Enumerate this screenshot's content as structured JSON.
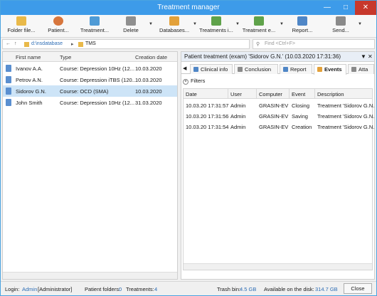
{
  "window": {
    "title": "Treatment manager"
  },
  "toolbar": {
    "buttons": [
      {
        "label": "Folder file..."
      },
      {
        "label": "Patient..."
      },
      {
        "label": "Treatment..."
      },
      {
        "label": "Delete"
      },
      {
        "label": "Databases..."
      },
      {
        "label": "Treatments i..."
      },
      {
        "label": "Treatment e..."
      },
      {
        "label": "Report..."
      },
      {
        "label": "Send..."
      }
    ]
  },
  "address": {
    "path_root": "d:\\nsdatabase",
    "path_folder": "TMS",
    "search_placeholder": "Find <Ctrl+F>"
  },
  "patients_grid": {
    "headers": [
      "First name",
      "Type",
      "Creation date"
    ],
    "rows": [
      {
        "name": "Ivanov A.A.",
        "type": "Course: Depression 10Hz (12...",
        "date": "10.03.2020"
      },
      {
        "name": "Petrov A.N.",
        "type": "Course: Depression iTBS (120...",
        "date": "10.03.2020"
      },
      {
        "name": "Sidorov G.N.",
        "type": "Course: OCD (SMA)",
        "date": "10.03.2020"
      },
      {
        "name": "John Smith",
        "type": "Course: Depression 10Hz (12...",
        "date": "31.03.2020"
      }
    ]
  },
  "detail": {
    "title": "Patient treatment (exam) 'Sidorov G.N.' (10.03.2020 17:31:36)",
    "tabs": [
      {
        "label": "Clinical info"
      },
      {
        "label": "Conclusion"
      },
      {
        "label": "Report"
      },
      {
        "label": "Events"
      },
      {
        "label": "Atta"
      }
    ],
    "filters_label": "Filters",
    "events": {
      "headers": [
        "Date",
        "User",
        "Computer",
        "Event",
        "Description"
      ],
      "rows": [
        {
          "date": "10.03.20 17:31:57",
          "user": "Admin",
          "computer": "GRASIN-EV",
          "event": "Closing",
          "desc": "Treatment 'Sidorov G.N."
        },
        {
          "date": "10.03.20 17:31:56",
          "user": "Admin",
          "computer": "GRASIN-EV",
          "event": "Saving",
          "desc": "Treatment 'Sidorov G.N."
        },
        {
          "date": "10.03.20 17:31:54",
          "user": "Admin",
          "computer": "GRASIN-EV",
          "event": "Creation",
          "desc": "Treatment 'Sidorov G.N."
        }
      ]
    }
  },
  "status": {
    "login_label": "Login:",
    "login_user": "Admin",
    "login_role": "[Administrator]",
    "folders_label": "Patient folders:",
    "folders_count": "0",
    "treatments_label": "Treatments:",
    "treatments_count": "4",
    "trash_label": "Trash bin:",
    "trash_value": "4.5 GB",
    "disk_label": "Available on the disk:",
    "disk_value": "314.7 GB",
    "close_label": "Close"
  },
  "colors": {
    "titlebar": "#3d9be9",
    "selection": "#cde4f7",
    "link": "#2d6db5"
  }
}
